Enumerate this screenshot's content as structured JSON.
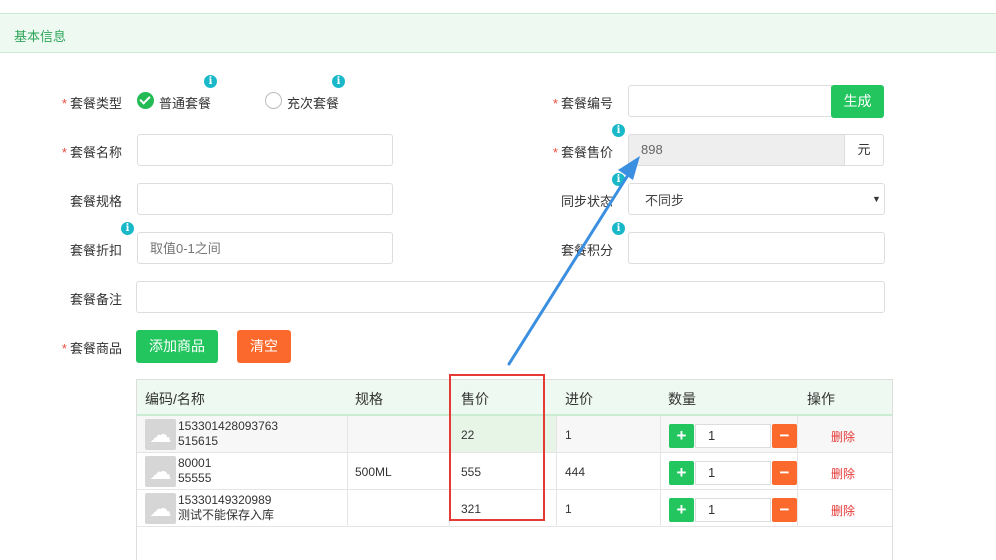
{
  "section": {
    "title": "基本信息"
  },
  "form": {
    "type_label": "套餐类型",
    "type_options": [
      "普通套餐",
      "充次套餐"
    ],
    "code_label": "套餐编号",
    "code_value": "",
    "generate_label": "生成",
    "name_label": "套餐名称",
    "name_value": "",
    "price_label": "套餐售价",
    "price_value": "898",
    "price_unit": "元",
    "spec_label": "套餐规格",
    "spec_value": "",
    "sync_label": "同步状态",
    "sync_value": "不同步",
    "discount_label": "套餐折扣",
    "discount_placeholder": "取值0-1之间",
    "points_label": "套餐积分",
    "points_value": "",
    "remark_label": "套餐备注",
    "remark_value": "",
    "goods_label": "套餐商品",
    "add_goods_label": "添加商品",
    "clear_label": "清空",
    "required_mark": "*",
    "info_glyph": "i"
  },
  "table": {
    "headers": [
      "编码/名称",
      "规格",
      "售价",
      "进价",
      "数量",
      "操作"
    ],
    "rows": [
      {
        "code": "153301428093763",
        "name": "515615",
        "spec": "",
        "price": "22",
        "cost": "1",
        "qty": "1",
        "action": "删除"
      },
      {
        "code": "80001",
        "name": "55555",
        "spec": "500ML",
        "price": "555",
        "cost": "444",
        "qty": "1",
        "action": "删除"
      },
      {
        "code": "15330149320989",
        "name": "测试不能保存入库",
        "spec": "",
        "price": "321",
        "cost": "1",
        "qty": "1",
        "action": "删除"
      }
    ],
    "plus_glyph": "+",
    "minus_glyph": "−",
    "thumb_glyph": "☁"
  },
  "colors": {
    "accent_green": "#22c55e",
    "accent_orange": "#fb6a2c",
    "info_teal": "#19b8c9",
    "annotation_red": "#e53935",
    "annotation_arrow": "#3b8fe0"
  }
}
